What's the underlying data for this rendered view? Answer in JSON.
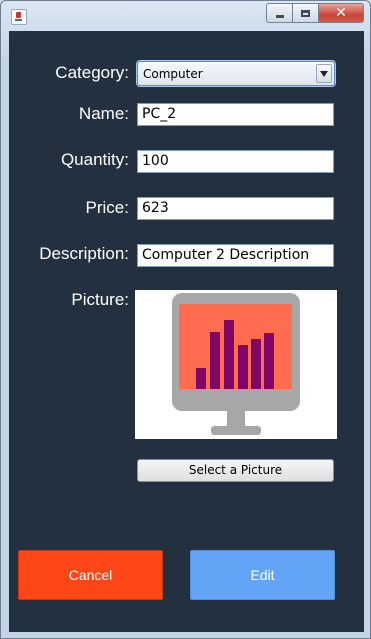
{
  "window": {
    "title": ""
  },
  "form": {
    "category_label": "Category:",
    "category_value": "Computer",
    "name_label": "Name:",
    "name_value": "PC_2",
    "quantity_label": "Quantity:",
    "quantity_value": "100",
    "price_label": "Price:",
    "price_value": "623",
    "description_label": "Description:",
    "description_value": "Computer 2 Description",
    "picture_label": "Picture:",
    "select_picture_label": "Select a Picture"
  },
  "buttons": {
    "cancel_label": "Cancel",
    "edit_label": "Edit"
  },
  "colors": {
    "panel_bg": "#223040",
    "cancel": "#fe4617",
    "edit": "#62a5f7",
    "screen": "#ff6c4f",
    "bars": "#800864",
    "monitor": "#a7a7a7"
  },
  "icons": {
    "window_icon": "java-icon",
    "picture": "monitor-chart-icon"
  }
}
